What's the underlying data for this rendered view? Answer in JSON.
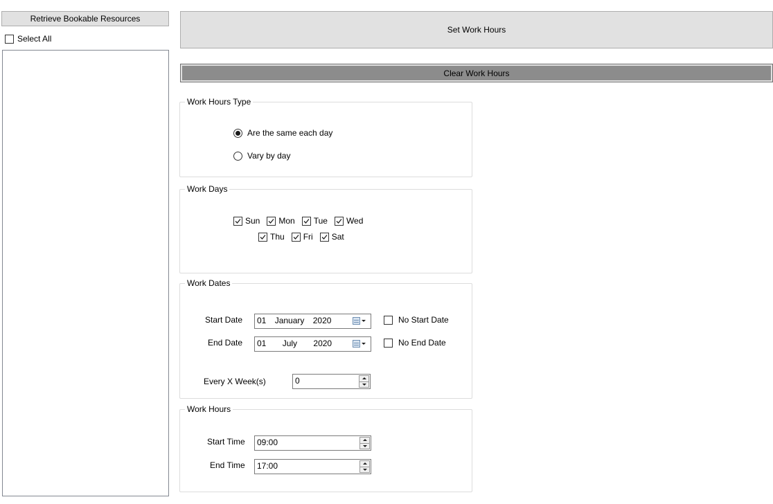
{
  "left_panel": {
    "retrieve_button": "Retrieve Bookable Resources",
    "select_all_label": "Select All",
    "select_all_checked": false,
    "resources": []
  },
  "main": {
    "set_button": "Set Work Hours",
    "clear_button": "Clear Work Hours",
    "work_hours_type": {
      "title": "Work Hours Type",
      "options": [
        {
          "label": "Are the same each day",
          "selected": true
        },
        {
          "label": "Vary by day",
          "selected": false
        }
      ]
    },
    "work_days": {
      "title": "Work Days",
      "days": [
        {
          "label": "Sun",
          "checked": true
        },
        {
          "label": "Mon",
          "checked": true
        },
        {
          "label": "Tue",
          "checked": true
        },
        {
          "label": "Wed",
          "checked": true
        },
        {
          "label": "Thu",
          "checked": true
        },
        {
          "label": "Fri",
          "checked": true
        },
        {
          "label": "Sat",
          "checked": true
        }
      ]
    },
    "work_dates": {
      "title": "Work Dates",
      "start_date_label": "Start Date",
      "start_day": "01",
      "start_month": "January",
      "start_year": "2020",
      "no_start_label": "No Start Date",
      "end_date_label": "End Date",
      "end_day": "01",
      "end_month": "July",
      "end_year": "2020",
      "no_end_label": "No End Date",
      "every_label": "Every X Week(s)",
      "every_value": "0"
    },
    "work_hours": {
      "title": "Work Hours",
      "start_time_label": "Start Time",
      "start_time": "09:00",
      "end_time_label": "End Time",
      "end_time": "17:00"
    }
  }
}
